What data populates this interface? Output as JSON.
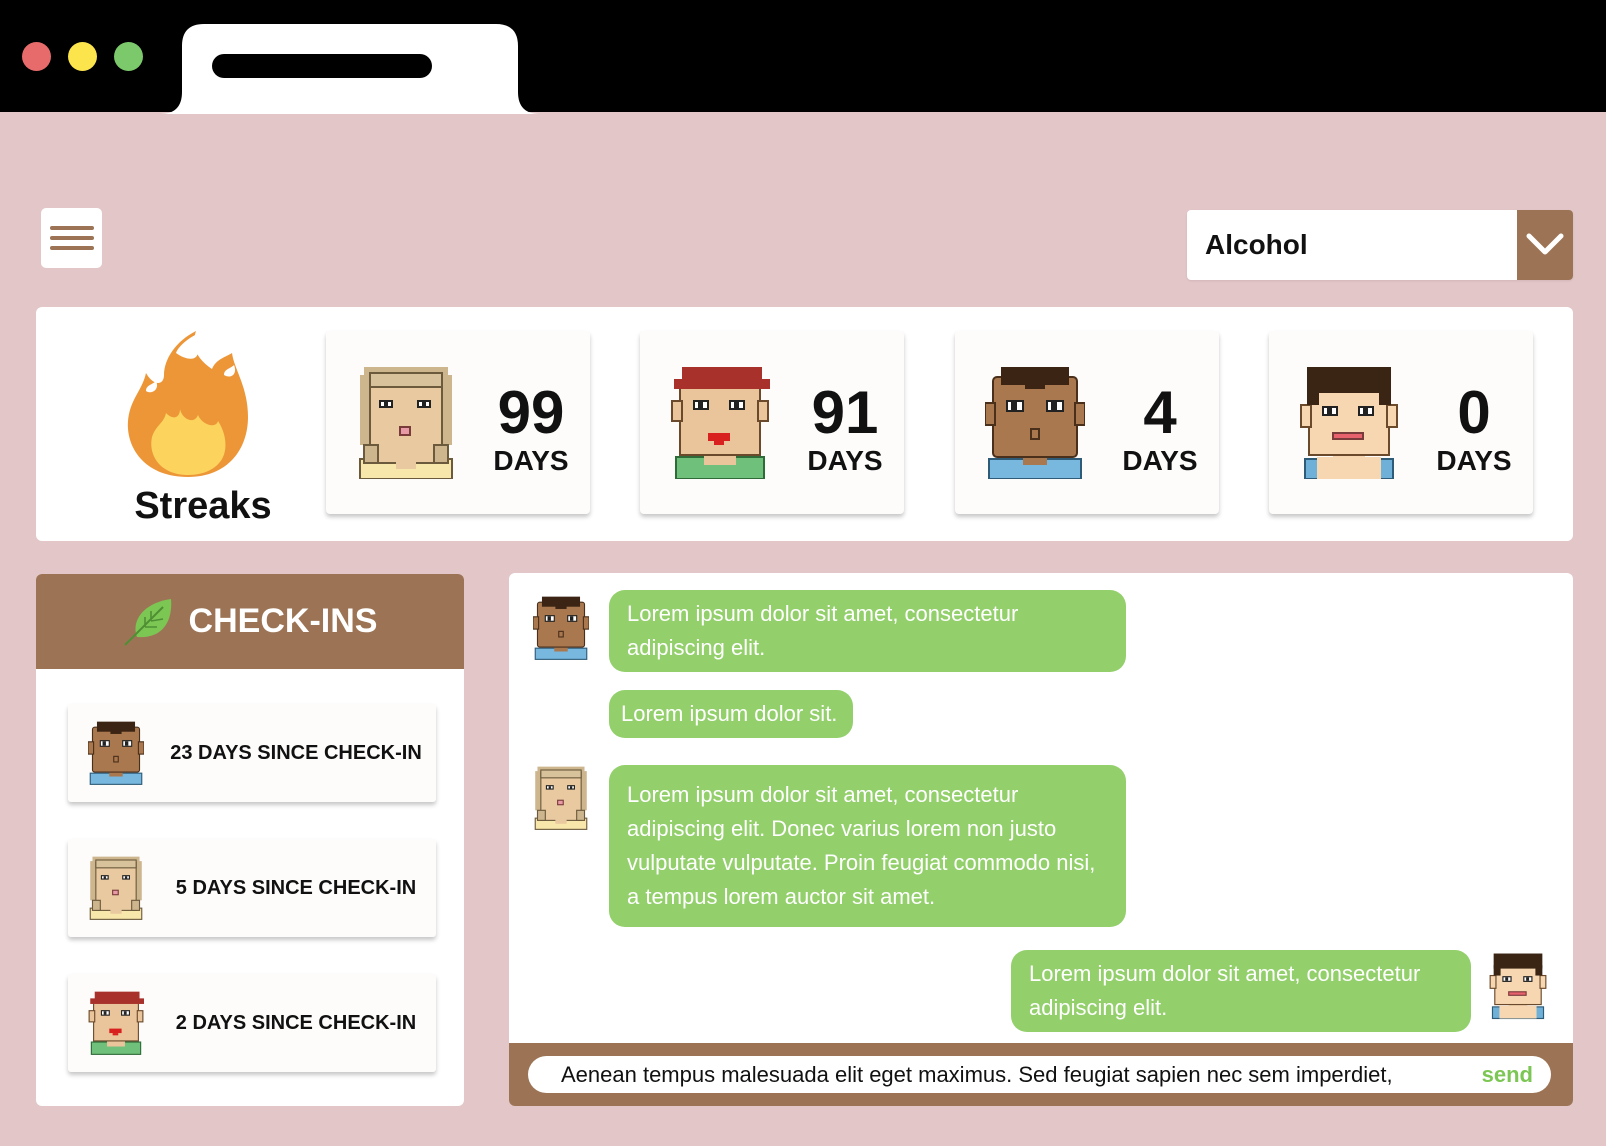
{
  "colors": {
    "page_bg": "#e2c6c8",
    "accent_brown": "#9c7455",
    "bubble_green": "#93d06c",
    "send_green": "#7cc654"
  },
  "window": {
    "controls": [
      "close-dot",
      "minimize-dot",
      "maximize-dot"
    ]
  },
  "header": {
    "menu_icon": "hamburger-icon",
    "dropdown": {
      "selected": "Alcohol",
      "icon": "chevron-down-icon"
    }
  },
  "streaks": {
    "title": "Streaks",
    "icon": "fire-icon",
    "cards": [
      {
        "avatar": "blonde-avatar",
        "value": "99",
        "unit": "DAYS"
      },
      {
        "avatar": "red-cap-avatar",
        "value": "91",
        "unit": "DAYS"
      },
      {
        "avatar": "brown-avatar",
        "value": "4",
        "unit": "DAYS"
      },
      {
        "avatar": "dark-hair-avatar",
        "value": "0",
        "unit": "DAYS"
      }
    ]
  },
  "checkins": {
    "title": "CHECK-INS",
    "icon": "leaf-icon",
    "items": [
      {
        "avatar": "brown-avatar",
        "label": "23 DAYS SINCE CHECK-IN"
      },
      {
        "avatar": "blonde-avatar",
        "label": "5 DAYS SINCE CHECK-IN"
      },
      {
        "avatar": "red-cap-avatar",
        "label": "2 DAYS SINCE CHECK-IN"
      }
    ]
  },
  "chat": {
    "messages": [
      {
        "avatar": "brown-avatar",
        "text": "Lorem ipsum dolor sit amet, consectetur adipiscing elit."
      },
      {
        "avatar": "brown-avatar",
        "text": "Lorem ipsum dolor sit."
      },
      {
        "avatar": "blonde-avatar",
        "text": "Lorem ipsum dolor sit amet, consectetur adipiscing elit. Donec varius lorem non justo vulputate vulputate. Proin feugiat commodo nisi, a tempus lorem auctor sit amet."
      },
      {
        "avatar": "dark-hair-avatar",
        "text": "Lorem ipsum dolor sit amet, consectetur adipiscing elit."
      }
    ],
    "input_value": "Aenean tempus malesuada elit eget maximus. Sed feugiat sapien nec sem imperdiet,",
    "send_label": "send"
  }
}
